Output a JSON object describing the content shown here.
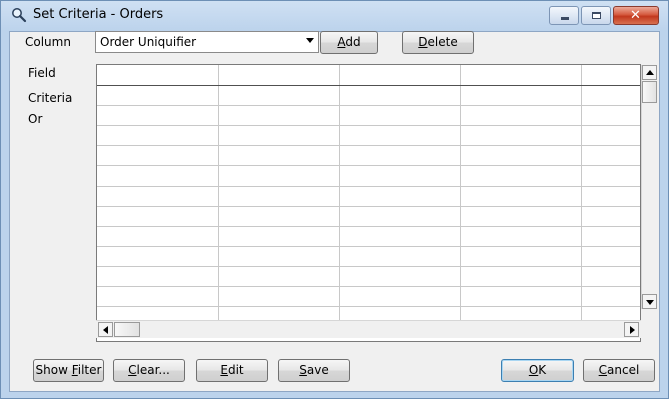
{
  "window": {
    "title": "Set Criteria - Orders"
  },
  "column_row": {
    "label": "Column",
    "selected": "Order Uniquifier",
    "add_prefix": "",
    "add_mnemonic": "A",
    "add_rest": "dd",
    "delete_prefix": "",
    "delete_mnemonic": "D",
    "delete_rest": "elete"
  },
  "row_labels": {
    "field": "Field",
    "criteria": "Criteria",
    "or": "Or"
  },
  "grid": {
    "columns": 5,
    "rows": 11
  },
  "buttons": {
    "show_filter_prefix": "Show ",
    "show_filter_mnemonic": "F",
    "show_filter_rest": "ilter",
    "clear_prefix": "",
    "clear_mnemonic": "C",
    "clear_rest": "lear...",
    "edit_prefix": "",
    "edit_mnemonic": "E",
    "edit_rest": "dit",
    "save_prefix": "",
    "save_mnemonic": "S",
    "save_rest": "ave",
    "ok_prefix": "",
    "ok_mnemonic": "O",
    "ok_rest": "K",
    "cancel_prefix": "",
    "cancel_mnemonic": "C",
    "cancel_rest": "ancel"
  },
  "icons": {
    "title": "magnifier-icon",
    "minimize": "minimize-icon",
    "maximize": "maximize-icon",
    "close": "close-icon",
    "combo": "chevron-down-icon"
  },
  "colors": {
    "title_bar": "#bcd3ec",
    "close_button": "#c2381e",
    "default_button_border": "#3c7fb1"
  }
}
